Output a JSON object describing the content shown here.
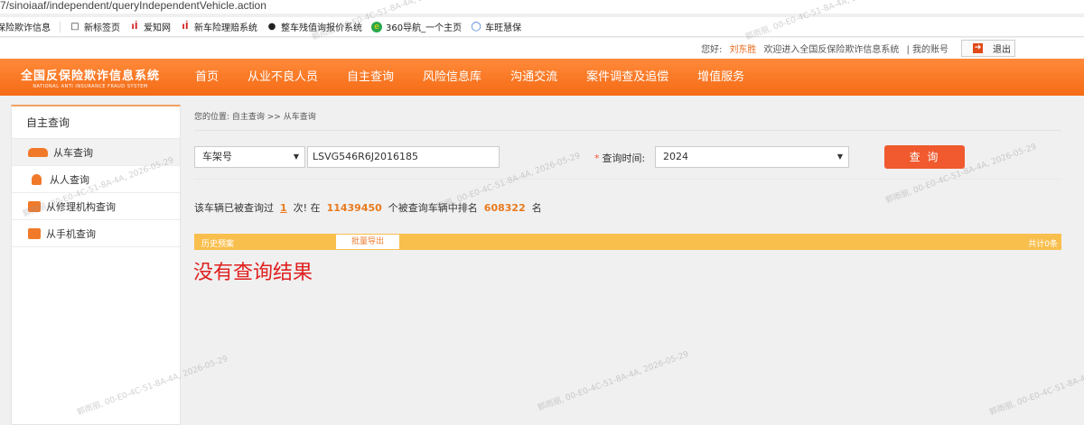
{
  "browser": {
    "url": "7/sinoiaaf/independent/queryIndependentVehicle.action",
    "bookmarks": [
      {
        "icon": "",
        "label": "保险欺诈信息"
      },
      {
        "icon": "page-icon",
        "label": "新标签页"
      },
      {
        "icon": "brand-icon",
        "label": "爱知网"
      },
      {
        "icon": "brand-icon",
        "label": "新车险理赔系统"
      },
      {
        "icon": "car-icon",
        "label": "整车残值询报价系统"
      },
      {
        "icon": "360-icon",
        "label": "360导航_一个主页"
      },
      {
        "icon": "shield-icon",
        "label": "车旺慧保"
      }
    ]
  },
  "userbar": {
    "greeting": "您好:",
    "username": "刘东胜",
    "welcome": "欢迎进入全国反保险欺诈信息系统",
    "my_account": "| 我的账号",
    "logout": "退出"
  },
  "header": {
    "logo_cn": "全国反保险欺诈信息系统",
    "logo_en": "NATIONAL ANTI INSURANCE FRAUD SYSTEM",
    "nav": [
      "首页",
      "从业不良人员",
      "自主查询",
      "风险信息库",
      "沟通交流",
      "案件调查及追偿",
      "增值服务"
    ]
  },
  "sidebar": {
    "title": "自主查询",
    "items": [
      {
        "label": "从车查询",
        "icon": "car-icon"
      },
      {
        "label": "从人查询",
        "icon": "person-icon"
      },
      {
        "label": "从修理机构查询",
        "icon": "repair-shop-icon"
      },
      {
        "label": "从手机查询",
        "icon": "phone-icon"
      }
    ]
  },
  "main": {
    "breadcrumb": "您的位置: 自主查询 >> 从车查询",
    "query_type": "车架号",
    "vin_value": "LSVG546R6J2016185",
    "time_required": "*",
    "time_label": "查询时间:",
    "year": "2024",
    "query_button": "查 询",
    "stats": {
      "prefix": "该车辆已被查询过",
      "times": "1",
      "mid1": "次! 在",
      "total": "11439450",
      "mid2": "个被查询车辆中排名",
      "rank": "608322",
      "suffix": "名"
    },
    "history": {
      "title": "历史预案",
      "export": "批量导出",
      "total": "共计0条"
    },
    "no_result": "没有查询结果"
  },
  "watermark": "郭雨丽, 00-E0-4C-51-8A-4A, 2026-05-29"
}
